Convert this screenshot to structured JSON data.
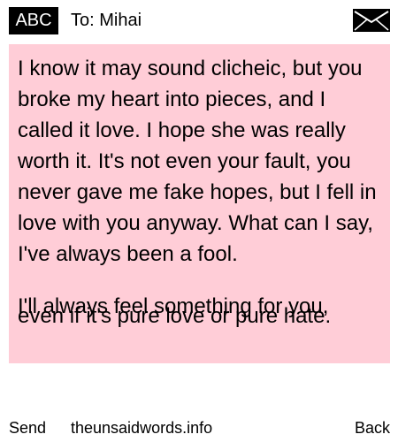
{
  "header": {
    "input_mode": "ABC",
    "recipient": "To: Mihai",
    "mail_icon": "envelope-icon"
  },
  "message": {
    "body": "I know it may sound clicheic, but you broke my heart into pieces, and I called it love. I hope she was really worth it. It's not even your fault, you never gave me fake hopes, but I fell in love with you anyway. What can I say, I've always been a fool.",
    "overlapping_line_1": "I'll always feel something for you,",
    "overlapping_line_2": "even if it's pure love or pure hate."
  },
  "footer": {
    "send_label": "Send",
    "site": "theunsaidwords.info",
    "back_label": "Back"
  },
  "colors": {
    "message_background": "#ffcdd7",
    "input_mode_background": "#000000",
    "text": "#000000"
  }
}
